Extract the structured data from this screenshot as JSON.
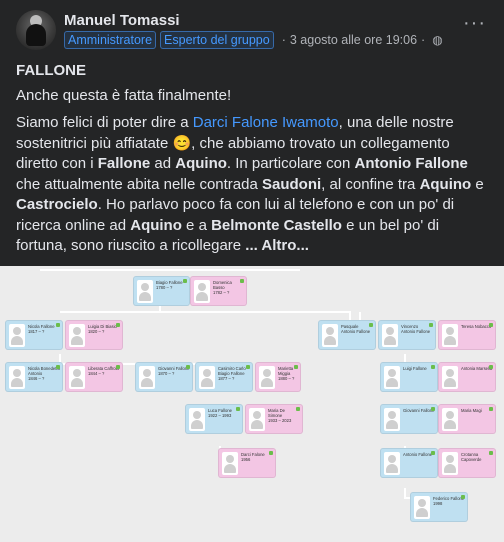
{
  "post": {
    "author": "Manuel Tomassi",
    "badges": [
      "Amministratore",
      "Esperto del gruppo"
    ],
    "timestamp": "3 agosto alle ore 19:06",
    "separator": "·",
    "privacy_icon": "globe-icon",
    "more_icon": "more-options-icon",
    "title": "FALLONE",
    "intro": "Anche questa è fatta finalmente!"
  },
  "body": {
    "s1": "Siamo felici di poter dire a ",
    "link_name": "Darci Falone Iwamoto",
    "s2": ", una delle nostre sostenitrici più affiatate ",
    "emoji": "😊",
    "s3": ", che abbiamo trovato un collegamento diretto con i ",
    "b1": "Fallone",
    "s4": " ad ",
    "b2": "Aquino",
    "s5": ". In particolare con ",
    "b3": "Antonio Fallone",
    "s6": " che attualmente abita nelle contrada ",
    "b4": "Saudoni",
    "s7": ", al confine tra ",
    "b5": "Aquino",
    "s8": " e ",
    "b6": "Castrocielo",
    "s9": ". Ho parlavo poco fa con lui al telefono e con un po' di ricerca online ad ",
    "b7": "Aquino",
    "s10": " e a ",
    "b8": "Belmonte Castello",
    "s11": " e un bel po' di fortuna, sono riuscito a ricollegare ",
    "more_label": "... Altro..."
  },
  "tree": {
    "cards": [
      {
        "name": "Biagio Fallone",
        "dates": "1780 – ?",
        "gender": "m"
      },
      {
        "name": "Domenica Basso",
        "dates": "1782 – ?",
        "gender": "f"
      },
      {
        "name": "Nicola Fallone",
        "dates": "1817 – ?",
        "gender": "m"
      },
      {
        "name": "Luigia Di Biasio",
        "dates": "1820 – ?",
        "gender": "f"
      },
      {
        "name": "Pasquale Antonio Fallone",
        "dates": "",
        "gender": "m"
      },
      {
        "name": "Vincenzo Antonio Fallone",
        "dates": "",
        "gender": "m"
      },
      {
        "name": "Teresa Nobacco",
        "dates": "",
        "gender": "f"
      },
      {
        "name": "Nicola Bonedetto Antonio",
        "dates": "1846 – ?",
        "gender": "m"
      },
      {
        "name": "Liberata Caffrola",
        "dates": "1844 – ?",
        "gender": "f"
      },
      {
        "name": "Giovanni Fallone",
        "dates": "1870 – ?",
        "gender": "m"
      },
      {
        "name": "Casimiro Carlo Biagio Fallone",
        "dates": "1877 – ?",
        "gender": "m"
      },
      {
        "name": "Marietta Miggia",
        "dates": "1880 – ?",
        "gender": "f"
      },
      {
        "name": "Luigi Fallone",
        "dates": "",
        "gender": "m"
      },
      {
        "name": "Antonia Marsella",
        "dates": "",
        "gender": "f"
      },
      {
        "name": "Luca Fallone",
        "dates": "1922 – 1993",
        "gender": "m"
      },
      {
        "name": "Maria De Simone",
        "dates": "1933 – 2023",
        "gender": "f"
      },
      {
        "name": "Giovanni Fallone",
        "dates": "",
        "gender": "m"
      },
      {
        "name": "Maria Magi",
        "dates": "",
        "gender": "f"
      },
      {
        "name": "Darci Falone",
        "dates": "1956",
        "gender": "f"
      },
      {
        "name": "Antonio Fallone",
        "dates": "",
        "gender": "m"
      },
      {
        "name": "Crotanna Capoverde",
        "dates": "",
        "gender": "f"
      },
      {
        "name": "Federico Fallone",
        "dates": "1998",
        "gender": "m"
      }
    ]
  }
}
